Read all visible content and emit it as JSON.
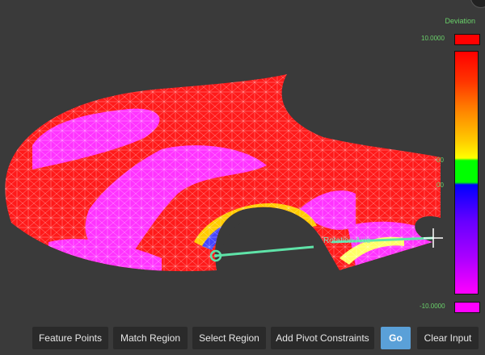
{
  "legend": {
    "title": "Deviation",
    "max_label": "10.0000",
    "min_label": "-10.0000",
    "colors": {
      "max": "#ff0000",
      "min": "#ff00ff",
      "in_tolerance": "#00ff00"
    },
    "upper_tick": "00",
    "lower_tick": "00"
  },
  "viewport": {
    "axis_label": "Rotation Axis",
    "mesh_colors": {
      "surface": "#ff1a1a",
      "low_region": "#ff33ff",
      "wire": "#ffffff"
    }
  },
  "toolbar": {
    "feature_points": "Feature Points",
    "match_region": "Match Region",
    "select_region": "Select Region",
    "add_pivot_constraints": "Add Pivot Constraints",
    "go": "Go",
    "clear_input": "Clear Input"
  }
}
